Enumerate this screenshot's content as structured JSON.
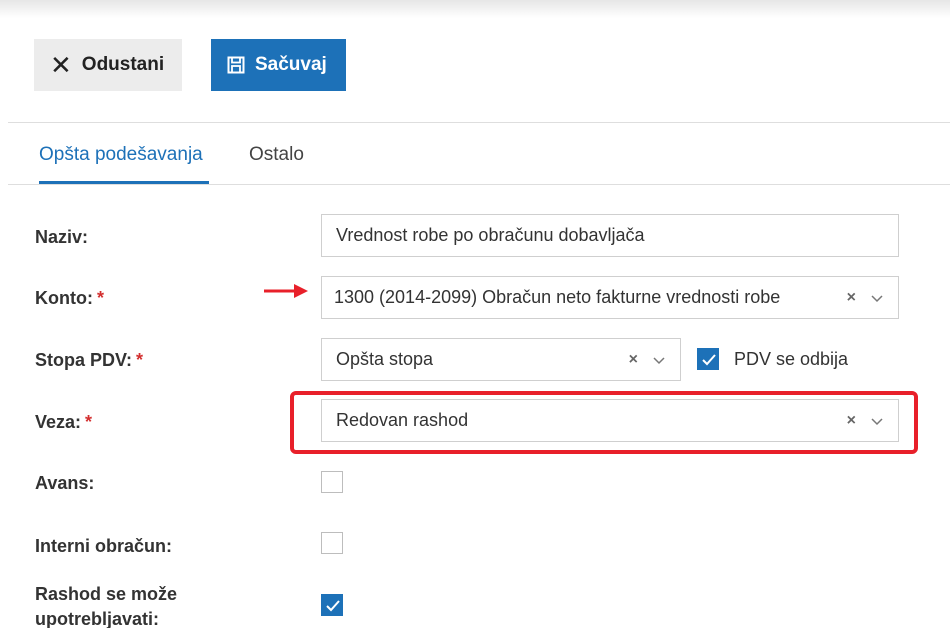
{
  "toolbar": {
    "cancel_label": "Odustani",
    "save_label": "Sačuvaj"
  },
  "tabs": [
    {
      "label": "Opšta podešavanja",
      "active": true
    },
    {
      "label": "Ostalo",
      "active": false
    }
  ],
  "form": {
    "naziv": {
      "label": "Naziv:",
      "value": "Vrednost robe po obračunu dobavljača"
    },
    "konto": {
      "label": "Konto:",
      "required": "*",
      "value": "1300 (2014-2099) Obračun neto fakturne vrednosti robe"
    },
    "stopa_pdv": {
      "label": "Stopa PDV:",
      "required": "*",
      "value": "Opšta stopa"
    },
    "pdv_se_odbija": {
      "label": "PDV se odbija",
      "checked": true
    },
    "veza": {
      "label": "Veza:",
      "required": "*",
      "value": "Redovan rashod"
    },
    "avans": {
      "label": "Avans:",
      "checked": false
    },
    "interni_obracun": {
      "label": "Interni obračun:",
      "checked": false
    },
    "rashod": {
      "label_line1": "Rashod se može",
      "label_line2": "upotrebljavati:",
      "checked": true
    }
  },
  "icons": {
    "clear": "×",
    "chevron": "chevron-down-icon"
  },
  "colors": {
    "accent": "#1d71b8",
    "highlight": "#e8202a",
    "required": "#d32f2f"
  }
}
